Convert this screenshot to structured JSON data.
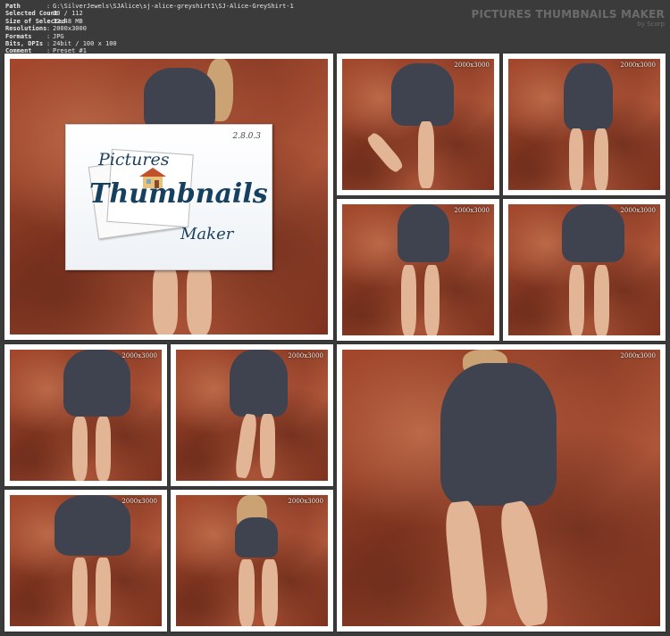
{
  "info": [
    {
      "key": "Path",
      "value": "G:\\SilverJewels\\SJAlice\\sj-alice-greyshirt1\\SJ-Alice-GreyShirt-1"
    },
    {
      "key": "Selected Count",
      "value": "10 / 112"
    },
    {
      "key": "Size of Selected",
      "value": "12.48 MB"
    },
    {
      "key": "Resolutions",
      "value": "2000x3000"
    },
    {
      "key": "Formats",
      "value": "JPG"
    },
    {
      "key": "Bits, DPIs",
      "value": "24bit / 100 x 100"
    },
    {
      "key": "Comment",
      "value": "Preset #1"
    }
  ],
  "brand": {
    "title": "PICTURES THUMBNAILS MAKER",
    "subtitle": "by Scorp"
  },
  "logo": {
    "version": "2.8.0.3",
    "word1": "Pictures",
    "word2": "Thumbnails",
    "word3": "Maker"
  },
  "thumbs": [
    {
      "res": "2000x3000"
    },
    {
      "res": "2000x3000"
    },
    {
      "res": "2000x3000"
    },
    {
      "res": "2000x3000"
    },
    {
      "res": "2000x3000"
    },
    {
      "res": "2000x3000"
    },
    {
      "res": "2000x3000"
    },
    {
      "res": "2000x3000"
    },
    {
      "res": "2000x3000"
    }
  ]
}
